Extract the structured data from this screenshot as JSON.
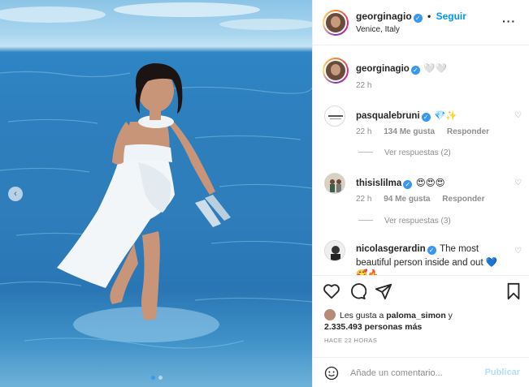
{
  "post": {
    "username": "georginagio",
    "separator": "•",
    "follow_label": "Seguir",
    "location": "Venice, Italy",
    "more_icon": "more-options-icon"
  },
  "caption": {
    "username": "georginagio",
    "text": "🤍🤍",
    "time": "22 h"
  },
  "comments": [
    {
      "username": "pasqualebruni",
      "text": "💎✨",
      "time": "22 h",
      "likes": "134 Me gusta",
      "reply": "Responder",
      "view_replies": "Ver respuestas (2)"
    },
    {
      "username": "thisislilma",
      "text": "😍😍😍",
      "time": "22 h",
      "likes": "94 Me gusta",
      "reply": "Responder",
      "view_replies": "Ver respuestas (3)"
    },
    {
      "username": "nicolasgerardin",
      "text": "The most beautiful person inside and out 💙",
      "extra": "🥰🔥"
    }
  ],
  "likes": {
    "prefix": "Les gusta a",
    "user": "paloma_simon",
    "connector": "y",
    "count": "2.335.493 personas más"
  },
  "timestamp": "HACE 22 HORAS",
  "comment_box": {
    "placeholder": "Añade un comentario...",
    "publish_label": "Publicar"
  },
  "colors": {
    "link": "#0095f6",
    "verified": "#3897f0",
    "muted": "#8e8e8e"
  }
}
